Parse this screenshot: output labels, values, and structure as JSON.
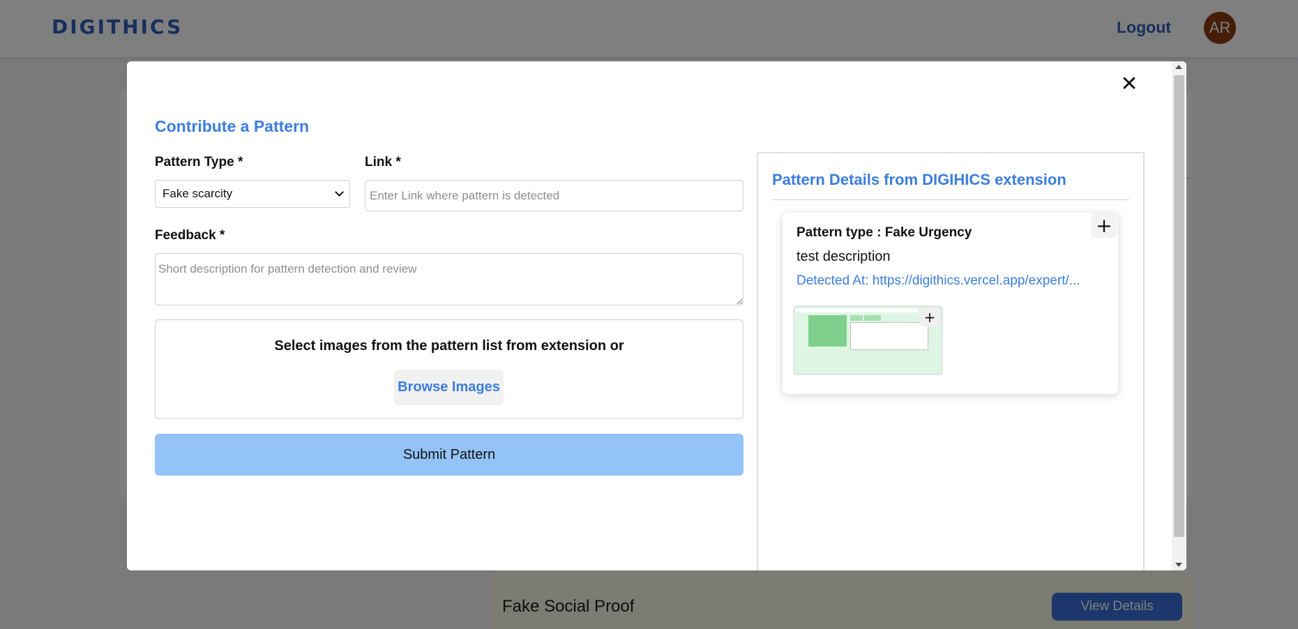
{
  "app": {
    "logo": "DIGITHICS",
    "logout_label": "Logout",
    "avatar_initials": "AR"
  },
  "background_list": {
    "pattern_title": "Fake Social Proof",
    "view_details_label": "View Details"
  },
  "modal": {
    "title": "Contribute a Pattern",
    "close_icon": "close-icon",
    "pattern_type_label": "Pattern Type *",
    "pattern_type_value": "Fake scarcity",
    "link_label": "Link *",
    "link_value": "",
    "link_placeholder": "Enter Link where pattern is detected",
    "feedback_label": "Feedback *",
    "feedback_value": "",
    "feedback_placeholder": "Short description for pattern detection and review",
    "dropzone_text": "Select images from the pattern list from extension or",
    "browse_label": "Browse Images",
    "submit_label": "Submit Pattern"
  },
  "details": {
    "title": "Pattern Details from DIGIHICS extension",
    "card": {
      "type_text": "Pattern type : Fake Urgency",
      "description": "test description",
      "detected_at": "Detected At: https://digithics.vercel.app/expert/...",
      "add_icon": "plus-icon",
      "thumbnail_add_icon": "plus-icon"
    }
  },
  "colors": {
    "accent": "#3b7ddd",
    "brand": "#2f5fb8",
    "submit_bg": "#93c3f7",
    "avatar_bg": "#8b3a12",
    "view_details_bg": "#3b6fd8"
  }
}
